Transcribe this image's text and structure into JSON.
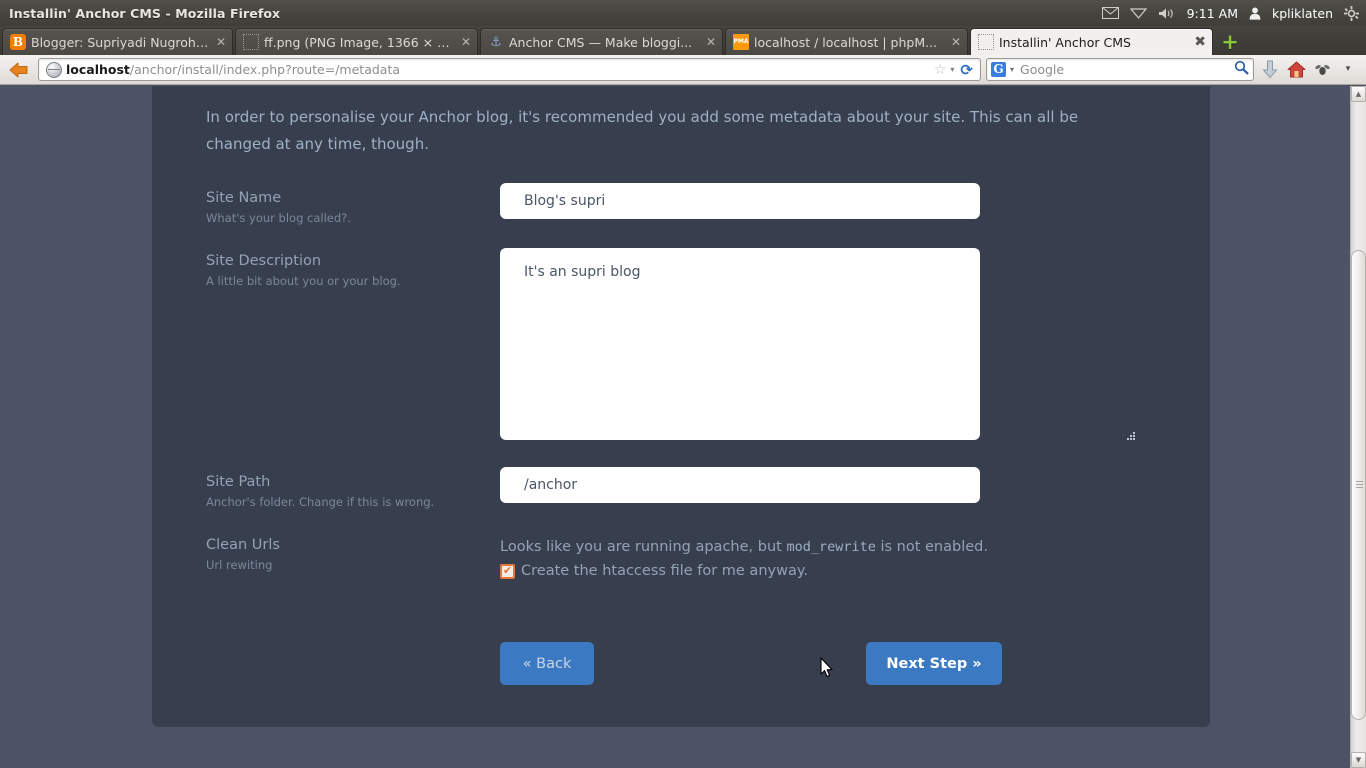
{
  "os": {
    "window_title": "Installin' Anchor CMS - Mozilla Firefox",
    "indicators": {
      "mail_icon": "envelope-icon",
      "network_icon": "wifi-icon",
      "volume_icon": "volume-icon",
      "time": "9:11 AM",
      "user_icon": "user-icon",
      "username": "kpliklaten",
      "settings_icon": "gear-icon"
    }
  },
  "browser": {
    "tabs": [
      {
        "label": "Blogger: Supriyadi Nugroho...",
        "favicon": "blogger-icon",
        "active": false
      },
      {
        "label": "ff.png (PNG Image, 1366 × 7...",
        "favicon": "blank-page-icon",
        "active": false
      },
      {
        "label": "Anchor CMS — Make bloggi...",
        "favicon": "anchor-icon",
        "active": false
      },
      {
        "label": "localhost / localhost | phpM...",
        "favicon": "phpmyadmin-icon",
        "active": false
      },
      {
        "label": "Installin' Anchor CMS",
        "favicon": "blank-page-icon",
        "active": true
      }
    ],
    "new_tab_label": "+",
    "close_label": "✖",
    "back_icon": "back-arrow-icon",
    "url": {
      "host": "localhost",
      "path": "/anchor/install/index.php?route=/metadata"
    },
    "url_icons": {
      "globe": "globe-icon",
      "star": "☆",
      "caret": "▾",
      "reload": "⟳"
    },
    "search": {
      "engine": "Google",
      "engine_icon": "google-icon",
      "caret": "▾",
      "magnifier": "search-icon"
    },
    "toolbar_icons": {
      "downloads": "downloads-icon",
      "home": "home-icon",
      "addons": "addons-icon",
      "more": "▾"
    }
  },
  "page": {
    "intro": "In order to personalise your Anchor blog, it's recommended you add some metadata about your site. This can all be changed at any time, though.",
    "fields": [
      {
        "label": "Site Name",
        "hint": "What's your blog called?.",
        "value": "Blog's supri",
        "type": "text"
      },
      {
        "label": "Site Description",
        "hint": "A little bit about you or your blog.",
        "value": "It's an supri blog",
        "type": "textarea"
      },
      {
        "label": "Site Path",
        "hint": "Anchor's folder. Change if this is wrong.",
        "value": "/anchor",
        "type": "text"
      }
    ],
    "clean_urls": {
      "label": "Clean Urls",
      "hint": "Url rewiting",
      "message_before": "Looks like you are running apache, but ",
      "message_code": "mod_rewrite",
      "message_after": " is not enabled.",
      "checkbox_label": "Create the htaccess file for me anyway.",
      "checkbox_checked": true,
      "checkbox_color": "#e8763b"
    },
    "buttons": {
      "back": "« Back",
      "next": "Next Step »",
      "accent_color": "#3b7ac2"
    },
    "colors": {
      "outer_bg": "#4b5364",
      "panel_bg": "#373f4e",
      "label_text": "#93a2b5",
      "hint_text": "#7b879a",
      "input_bg": "#ffffff",
      "input_text": "#4a5568"
    }
  }
}
